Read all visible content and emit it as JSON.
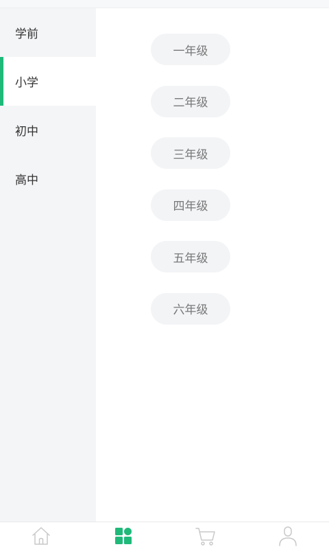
{
  "sidebar": {
    "items": [
      {
        "label": "学前"
      },
      {
        "label": "小学"
      },
      {
        "label": "初中"
      },
      {
        "label": "高中"
      }
    ],
    "active_index": 1
  },
  "grades": [
    {
      "label": "一年级"
    },
    {
      "label": "二年级"
    },
    {
      "label": "三年级"
    },
    {
      "label": "四年级"
    },
    {
      "label": "五年级"
    },
    {
      "label": "六年级"
    }
  ],
  "tabbar": {
    "tabs": [
      {
        "icon": "home-icon"
      },
      {
        "icon": "category-icon",
        "active": true
      },
      {
        "icon": "cart-icon"
      },
      {
        "icon": "user-icon"
      }
    ]
  },
  "colors": {
    "accent": "#1fb97a",
    "sidebar_bg": "#f4f5f7",
    "pill_bg": "#f3f4f6",
    "inactive_icon": "#c8c8c8"
  }
}
